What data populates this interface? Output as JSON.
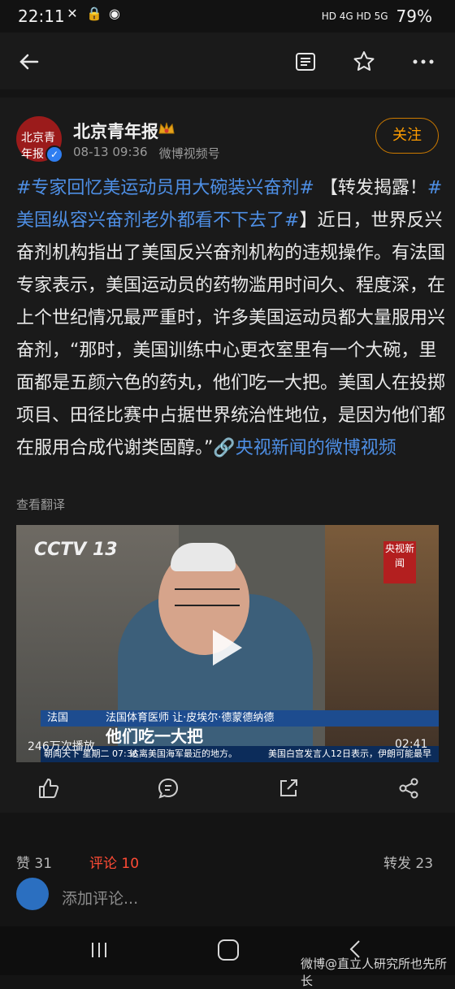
{
  "status_bar": {
    "time": "22:11",
    "right_text": "HD  4G  HD  5G",
    "battery": "79%"
  },
  "post": {
    "author": "北京青年报",
    "avatar_text": "北京青年报",
    "date": "08-13 09:36",
    "source": "微博视频号",
    "follow_label": "关注",
    "tag1": "#专家回忆美运动员用大碗装兴奋剂#",
    "text1": " 【转发揭露！",
    "tag2": "#美国纵容兴奋剂老外都看不下去了#",
    "text2": "】近日，世界反兴奋剂机构指出了美国反兴奋剂机构的违规操作。有法国专家表示，美国运动员的药物滥用时间久、程度深，在上个世纪情况最严重时，许多美国运动员都大量服用兴奋剂，“那时，美国训练中心更衣室里有一个大碗，里面都是五颜六色的药丸，他们吃一大把。美国人在投掷项目、田径比赛中占据世界统治性地位，是因为他们都在服用合成代谢类固醇。”",
    "link_text": "🔗央视新闻的微博视频",
    "translate_label": "查看翻译"
  },
  "video": {
    "channel_logo": "CCTV 13",
    "corner_logo": "央视新闻",
    "lower_third_country": "法国",
    "lower_third_name": "法国体育医师 让·皮埃尔·德蒙德纳德",
    "subtitle": "他们吃一大把",
    "ticker_left": "朝闻天下  星期二 07:36",
    "ticker_text": "达离美国海军最近的地方。",
    "ticker_text2": "美国白宫发言人12日表示，伊朗可能最早在本",
    "views": "246万次播放",
    "duration": "02:41"
  },
  "stats": {
    "like": "赞 31",
    "comment": "评论 10",
    "repost": "转发 23"
  },
  "comment_input": {
    "placeholder": "添加评论..."
  },
  "watermark": "微博@直立人研究所也先所长"
}
